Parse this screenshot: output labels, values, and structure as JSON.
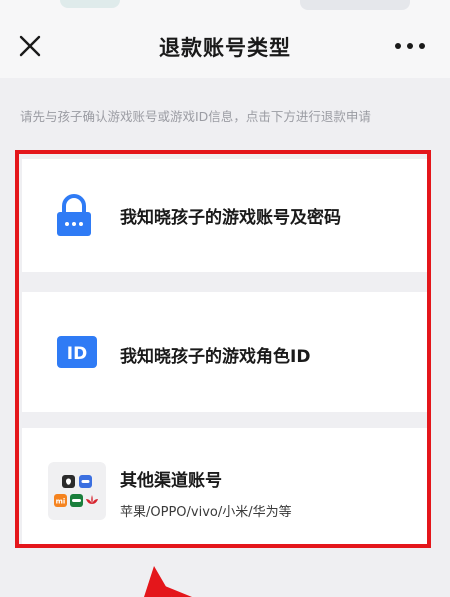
{
  "nav": {
    "title": "退款账号类型",
    "close_icon": "close-icon",
    "more_icon": "more-horizontal-icon"
  },
  "hint": "请先与孩子确认游戏账号或游戏ID信息，点击下方进行退款申请",
  "options": [
    {
      "label": "我知晓孩子的游戏账号及密码",
      "icon": "lock-icon"
    },
    {
      "label": "我知晓孩子的游戏角色ID",
      "icon": "id-badge-icon",
      "icon_text": "ID"
    },
    {
      "label": "其他渠道账号",
      "sub": "苹果/OPPO/vivo/小米/华为等",
      "icon": "app-grid-icon"
    }
  ],
  "colors": {
    "accent_blue": "#2f7bf5",
    "highlight_red": "#e4161b",
    "page_bg": "#efeff2"
  }
}
